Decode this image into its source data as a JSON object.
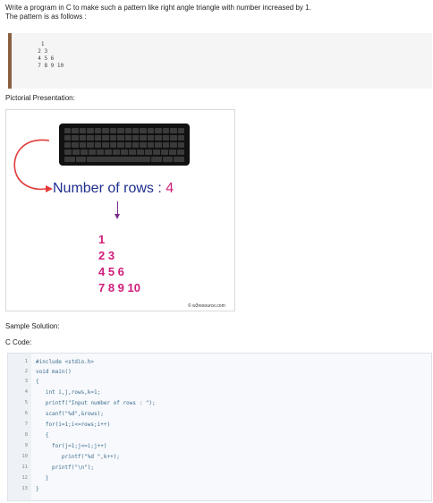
{
  "intro": {
    "line1": "Write a program in C to make such a pattern like right angle triangle with number increased by 1.",
    "line2": "The pattern is as follows :"
  },
  "pattern": {
    "lines": [
      "   1",
      "  2 3",
      "  4 5 6",
      "  7 8 9 10"
    ]
  },
  "pictorial": {
    "heading": "Pictorial Presentation:",
    "rows_label": "Number of rows : ",
    "rows_value": "4",
    "triangle_lines": [
      "1",
      "2 3",
      "4 5 6",
      "7 8 9 10"
    ],
    "logo": "© w3resource.com"
  },
  "solution": {
    "sample_heading": "Sample Solution:",
    "code_heading": "C Code:",
    "code_lines": [
      {
        "n": "1",
        "text": "#include <stdio.h>"
      },
      {
        "n": "2",
        "text": "void main()"
      },
      {
        "n": "3",
        "text": "{"
      },
      {
        "n": "4",
        "text": "   int i,j,rows,k=1;"
      },
      {
        "n": "5",
        "text": "   printf(\"Input number of rows : \");"
      },
      {
        "n": "6",
        "text": "   scanf(\"%d\",&rows);"
      },
      {
        "n": "7",
        "text": "   for(i=1;i<=rows;i++)"
      },
      {
        "n": "8",
        "text": "   {"
      },
      {
        "n": "9",
        "text": "     for(j=1;j<=i;j++)"
      },
      {
        "n": "10",
        "text": "        printf(\"%d \",k++);"
      },
      {
        "n": "11",
        "text": "     printf(\"\\n\");"
      },
      {
        "n": "12",
        "text": "   }"
      },
      {
        "n": "13",
        "text": "}"
      }
    ]
  }
}
